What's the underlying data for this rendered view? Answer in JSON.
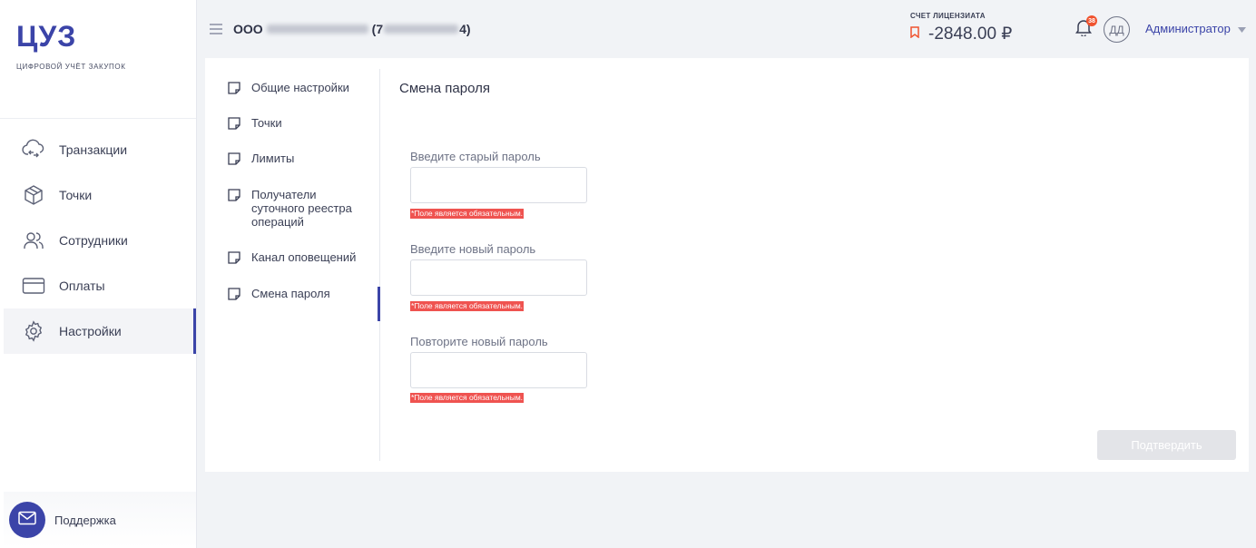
{
  "brand": {
    "title": "ЦУЗ",
    "subtitle": "ЦИФРОВОЙ УЧЁТ ЗАКУПОК",
    "accent_color": "#3b44a8"
  },
  "sidebar": {
    "items": [
      {
        "label": "Транзакции",
        "icon": "cloud-sync-icon",
        "active": false
      },
      {
        "label": "Точки",
        "icon": "box-icon",
        "active": false
      },
      {
        "label": "Сотрудники",
        "icon": "users-icon",
        "active": false
      },
      {
        "label": "Оплаты",
        "icon": "card-icon",
        "active": false
      },
      {
        "label": "Настройки",
        "icon": "gear-icon",
        "active": true
      }
    ],
    "support_label": "Поддержка"
  },
  "header": {
    "org_prefix": "ООО",
    "org_paren_open": "(7",
    "org_paren_close": "4)",
    "account_label": "СЧЕТ ЛИЦЕНЗИАТА",
    "account_amount": "-2848.00 ₽",
    "notifications_count": "38",
    "avatar_initials": "ДД",
    "user_name": "Администратор"
  },
  "settings_nav": {
    "items": [
      {
        "label": "Общие настройки"
      },
      {
        "label": "Точки"
      },
      {
        "label": "Лимиты"
      },
      {
        "label": "Получатели суточного реестра операций"
      },
      {
        "label": "Канал оповещений"
      },
      {
        "label": "Смена пароля",
        "active": true
      }
    ]
  },
  "form": {
    "title": "Смена пароля",
    "old_password": {
      "label": "Введите старый пароль",
      "value": "",
      "error": "*Поле является обязательным."
    },
    "new_password": {
      "label": "Введите новый пароль",
      "value": "",
      "error": "*Поле является обязательным."
    },
    "repeat_password": {
      "label": "Повторите новый пароль",
      "value": "",
      "error": "*Поле является обязательным."
    },
    "submit_label": "Подтвердить"
  }
}
